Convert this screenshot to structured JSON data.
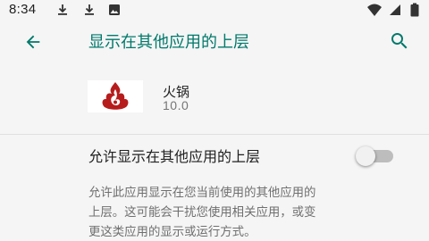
{
  "status_bar": {
    "time": "8:34",
    "left_icons": [
      "download-icon",
      "download-icon",
      "photo-icon"
    ],
    "right_icons": [
      "wifi-icon",
      "signal-icon",
      "battery-icon"
    ]
  },
  "toolbar": {
    "title": "显示在其他应用的上层",
    "back_icon": "arrow-back-icon",
    "search_icon": "search-icon",
    "accent_color": "#00796b"
  },
  "app": {
    "name": "火锅",
    "version": "10.0",
    "icon": "hotpot-flame-logo",
    "logo_color": "#b71c1c"
  },
  "setting": {
    "label": "允许显示在其他应用的上层",
    "enabled": false
  },
  "description": {
    "lines": [
      "允许此应用显示在您当前使用的其他应用的",
      "上层。这可能会干扰您使用相关应用，或变",
      "更这类应用的显示或运行方式。"
    ]
  }
}
